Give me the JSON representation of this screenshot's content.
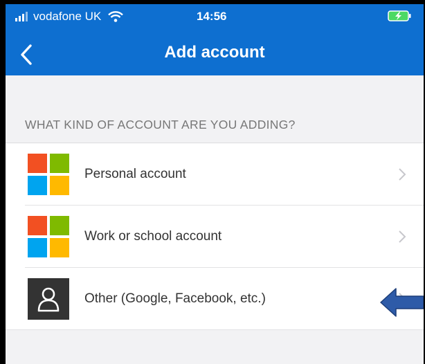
{
  "status_bar": {
    "carrier": "vodafone UK",
    "time": "14:56",
    "signal_icon": "cellular-signal-icon",
    "wifi_icon": "wifi-icon",
    "battery_icon": "battery-charging-icon"
  },
  "header": {
    "back_icon": "chevron-left-icon",
    "title": "Add account"
  },
  "section": {
    "header": "WHAT KIND OF ACCOUNT ARE YOU ADDING?"
  },
  "account_types": [
    {
      "label": "Personal account",
      "icon": "microsoft-logo-icon"
    },
    {
      "label": "Work or school account",
      "icon": "microsoft-logo-icon"
    },
    {
      "label": "Other (Google, Facebook, etc.)",
      "icon": "person-icon"
    }
  ],
  "colors": {
    "header_blue": "#0E6FD0",
    "ms_red": "#F25022",
    "ms_green": "#7FBA00",
    "ms_blue": "#00A4EF",
    "ms_yellow": "#FFB900",
    "annotation_arrow": "#2E5BA8"
  },
  "annotation": {
    "icon": "left-pointing-arrow-icon"
  }
}
